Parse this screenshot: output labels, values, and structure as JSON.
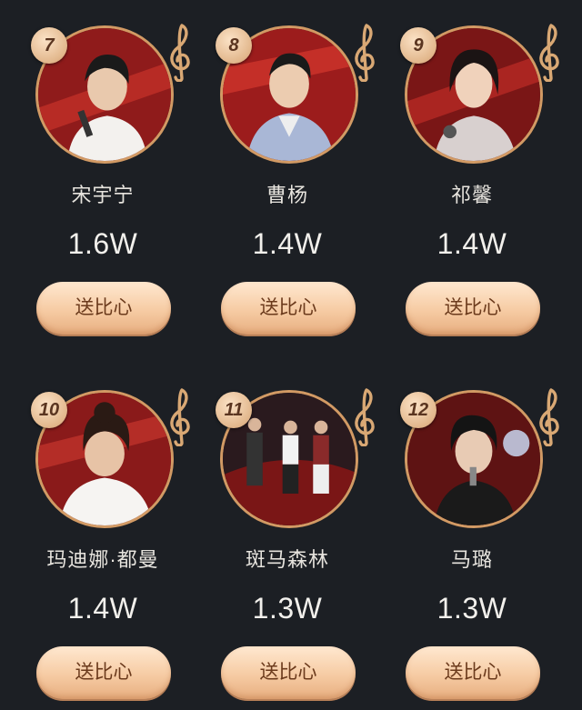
{
  "contestants": [
    {
      "rank": "7",
      "name": "宋宇宁",
      "votes": "1.6W",
      "button": "送比心",
      "bg": "#8f1b1b"
    },
    {
      "rank": "8",
      "name": "曹杨",
      "votes": "1.4W",
      "button": "送比心",
      "bg": "#9c1c1c"
    },
    {
      "rank": "9",
      "name": "祁馨",
      "votes": "1.4W",
      "button": "送比心",
      "bg": "#7a1616"
    },
    {
      "rank": "10",
      "name": "玛迪娜·都曼",
      "votes": "1.4W",
      "button": "送比心",
      "bg": "#8a1a1a"
    },
    {
      "rank": "11",
      "name": "斑马森林",
      "votes": "1.3W",
      "button": "送比心",
      "bg": "#2a1a1e"
    },
    {
      "rank": "12",
      "name": "马璐",
      "votes": "1.3W",
      "button": "送比心",
      "bg": "#5e1313"
    }
  ],
  "colors": {
    "background": "#1c1f24",
    "ring": "#d29a64",
    "button_top": "#ffe8d0",
    "button_bottom": "#e7ae80",
    "button_text": "#6b3a1c"
  }
}
